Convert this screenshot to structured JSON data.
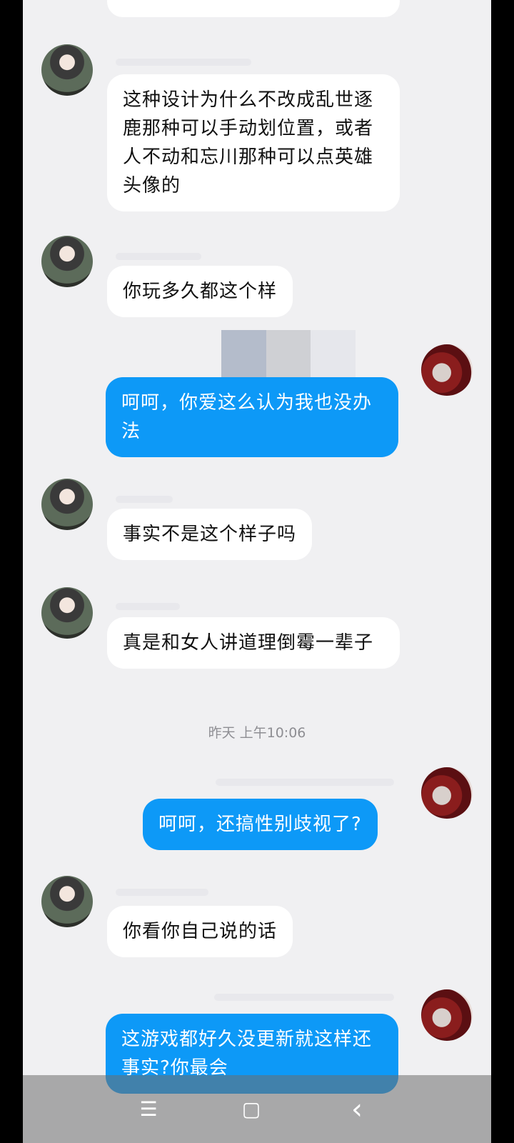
{
  "messages": [
    {
      "side": "in",
      "text": "这种设计为什么不改成乱世逐鹿那种可以手动划位置，或者人不动和忘川那种可以点英雄头像的"
    },
    {
      "side": "in",
      "text": "你玩多久都这个样"
    },
    {
      "side": "out",
      "text": "呵呵，你爱这么认为我也没办法"
    },
    {
      "side": "in",
      "text": "事实不是这个样子吗"
    },
    {
      "side": "in",
      "text": "真是和女人讲道理倒霉一辈子"
    },
    {
      "side": "out",
      "text": "呵呵，还搞性别歧视了?"
    },
    {
      "side": "in",
      "text": "你看你自己说的话"
    },
    {
      "side": "out",
      "text": "这游戏都好久没更新就这样还事实?你最会"
    }
  ],
  "timestamp": "昨天 上午10:06",
  "nav": {
    "menu": "☰",
    "home": "▢",
    "back": "‹"
  },
  "colors": {
    "outgoing": "#0d99f7",
    "incoming": "#ffffff",
    "background": "#f0f0f2"
  }
}
